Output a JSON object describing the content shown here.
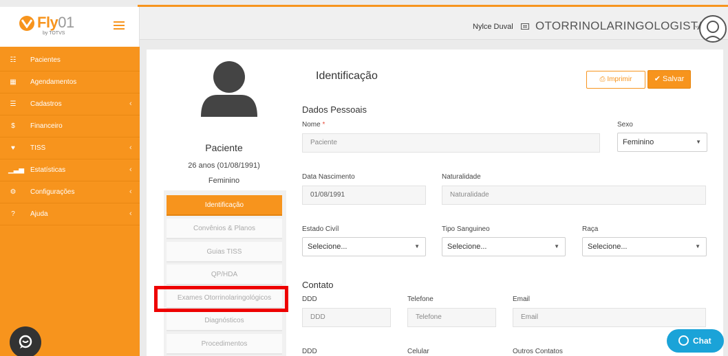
{
  "brand": {
    "name": "Fly",
    "suffix": "01",
    "sub": "by TOTVS"
  },
  "sidebar": {
    "items": [
      {
        "icon": "users-icon",
        "glyph": "☷",
        "label": "Pacientes",
        "caret": false
      },
      {
        "icon": "calendar-icon",
        "glyph": "▦",
        "label": "Agendamentos",
        "caret": false
      },
      {
        "icon": "list-icon",
        "glyph": "☰",
        "label": "Cadastros",
        "caret": true
      },
      {
        "icon": "dollar-icon",
        "glyph": "$",
        "label": "Financeiro",
        "caret": false
      },
      {
        "icon": "heartbeat-icon",
        "glyph": "♥",
        "label": "TISS",
        "caret": true
      },
      {
        "icon": "bar-chart-icon",
        "glyph": "▁▃▅",
        "label": "Estatísticas",
        "caret": true
      },
      {
        "icon": "gear-icon",
        "glyph": "⚙",
        "label": "Configurações",
        "caret": true
      },
      {
        "icon": "question-icon",
        "glyph": "?",
        "label": "Ajuda",
        "caret": true
      }
    ],
    "caret_glyph": "‹"
  },
  "header": {
    "user": "Nylce Duval",
    "specialty": "OTORRINOLARINGOLOGISTA",
    "caret": "⌄"
  },
  "profile": {
    "name": "Paciente",
    "age": "26 anos (01/08/1991)",
    "sex": "Feminino"
  },
  "tabs": [
    "Identificação",
    "Convênios & Planos",
    "Guias TISS",
    "QP/HDA",
    "Exames Otorrinolaringológicos",
    "Diagnósticos",
    "Procedimentos"
  ],
  "main": {
    "title": "Identificação",
    "print_label": "Imprimir",
    "save_label": "Salvar",
    "personal": {
      "title": "Dados Pessoais",
      "nome_label": "Nome",
      "nome_required": "*",
      "nome_value": "Paciente",
      "sexo_label": "Sexo",
      "sexo_value": "Feminino",
      "nasc_label": "Data Nascimento",
      "nasc_value": "01/08/1991",
      "natural_label": "Naturalidade",
      "natural_placeholder": "Naturalidade",
      "civil_label": "Estado Civíl",
      "civil_value": "Selecione...",
      "sangue_label": "Tipo Sanguineo",
      "sangue_value": "Selecione...",
      "raca_label": "Raça",
      "raca_value": "Selecione..."
    },
    "contact": {
      "title": "Contato",
      "ddd_label": "DDD",
      "ddd_placeholder": "DDD",
      "tel_label": "Telefone",
      "tel_placeholder": "Telefone",
      "email_label": "Email",
      "email_placeholder": "Email",
      "ddd2_label": "DDD",
      "cel_label": "Celular",
      "outros_label": "Outros Contatos"
    },
    "select_caret": "▼"
  },
  "chat": {
    "label": "Chat"
  },
  "colors": {
    "accent": "#f7941d",
    "chat": "#1aa3d8",
    "highlight": "#ee0000"
  }
}
